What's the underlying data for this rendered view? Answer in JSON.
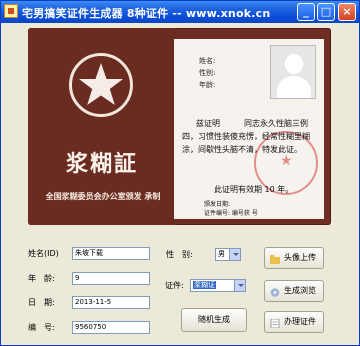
{
  "window": {
    "title": "宅男搞笑证件生成器 8种证件 -- www.xnok.cn"
  },
  "certificate": {
    "title": "浆糊証",
    "issuer": "全国浆糊委员会办公室颁发 承制",
    "fields": {
      "name_label": "姓名:",
      "gender_label": "性别:",
      "age_label": "年龄:"
    },
    "body_text": "兹证明　　　同志永久性脑三例四，习惯性装傻充愣，经常性糊里糊涂，间歇性头脑不清，特发此证。",
    "validity": "此证明有效期 10 年。",
    "footer_line1": "颁发日期:",
    "footer_line2": "证件编号: 编号获 号"
  },
  "form": {
    "name_label": "姓名(ID)",
    "name_value": "朱坡下载",
    "age_label": "年　龄:",
    "age_value": "9",
    "date_label": "日　期:",
    "date_value": "2013-11-5",
    "number_label": "编　号:",
    "number_value": "9560750",
    "gender_label": "性　别:",
    "gender_value": "男",
    "cert_label": "证件:",
    "cert_value": "浆糊证",
    "random_button": "随机生成",
    "upload_button": "头像上传",
    "preview_button": "生成浏览",
    "apply_button": "办理证件"
  }
}
